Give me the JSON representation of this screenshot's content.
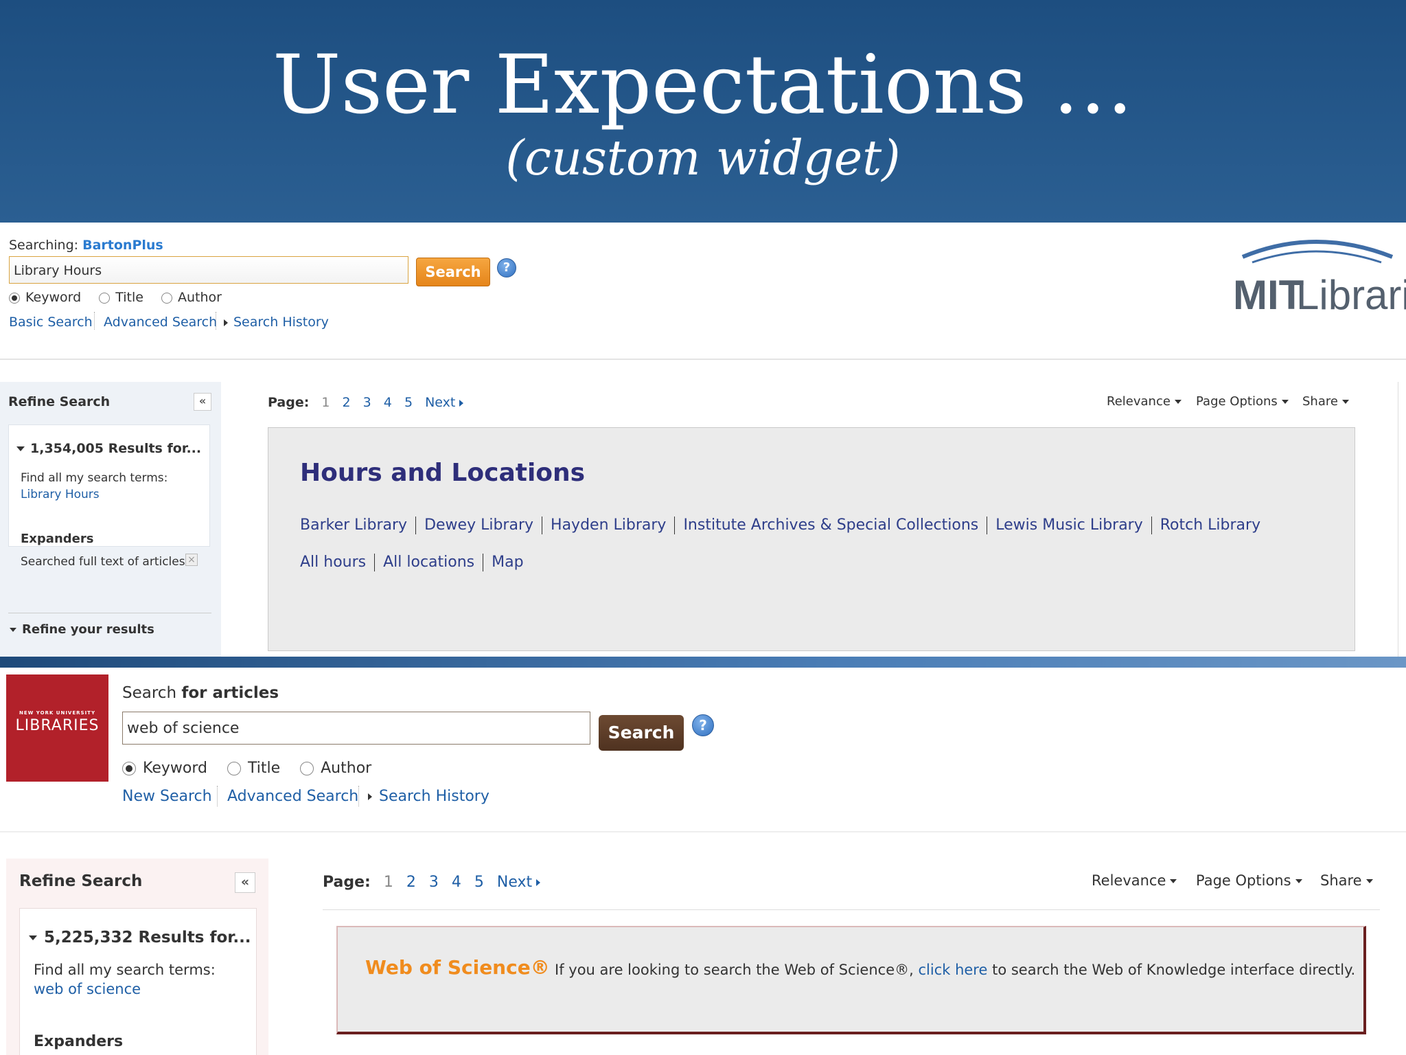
{
  "slide": {
    "title": "User Expectations …",
    "subtitle": "(custom widget)"
  },
  "mit": {
    "searching_label": "Searching:",
    "searching_db": "BartonPlus",
    "search_value": "Library Hours",
    "search_button": "Search",
    "help": "?",
    "radios": [
      "Keyword",
      "Title",
      "Author"
    ],
    "selected_radio": "Keyword",
    "links": {
      "basic": "Basic Search",
      "advanced": "Advanced Search",
      "history": "Search History"
    },
    "logo_text_bold": "MIT",
    "logo_text_light": "Libraries",
    "sidebar": {
      "refine_title": "Refine Search",
      "collapse": "«",
      "results": "1,354,005 Results for...",
      "find_label": "Find all my search terms:",
      "find_value": "Library Hours",
      "expanders_title": "Expanders",
      "expander_item": "Searched full text of articles",
      "remove": "×",
      "refine_results": "Refine your results"
    },
    "paging": {
      "label": "Page:",
      "current": "1",
      "pages": [
        "2",
        "3",
        "4",
        "5"
      ],
      "next": "Next"
    },
    "toolbar": {
      "relevance": "Relevance",
      "page_options": "Page Options",
      "share": "Share"
    },
    "widget": {
      "title": "Hours and Locations",
      "row1": [
        "Barker Library",
        "Dewey Library",
        "Hayden Library",
        "Institute Archives & Special Collections",
        "Lewis Music Library",
        "Rotch Library"
      ],
      "row2": [
        "All hours",
        "All locations",
        "Map"
      ]
    }
  },
  "nyu": {
    "logo_small": "NEW YORK UNIVERSITY",
    "logo_big": "LIBRARIES",
    "search_label_pre": "Search",
    "search_label_bold": "for articles",
    "search_value": "web of science",
    "search_button": "Search",
    "help": "?",
    "radios": [
      "Keyword",
      "Title",
      "Author"
    ],
    "selected_radio": "Keyword",
    "links": {
      "new": "New Search",
      "advanced": "Advanced Search",
      "history": "Search History"
    },
    "sidebar": {
      "refine_title": "Refine Search",
      "collapse": "«",
      "results": "5,225,332 Results for...",
      "find_label": "Find all my search terms:",
      "find_value": "web of science",
      "expanders_title": "Expanders"
    },
    "paging": {
      "label": "Page:",
      "current": "1",
      "pages": [
        "2",
        "3",
        "4",
        "5"
      ],
      "next": "Next"
    },
    "toolbar": {
      "relevance": "Relevance",
      "page_options": "Page Options",
      "share": "Share"
    },
    "widget": {
      "title": "Web of Science®",
      "text_pre": "If you are looking to search the Web of Science®,",
      "link": "click here",
      "text_post": "to search the Web of Knowledge interface directly."
    }
  }
}
